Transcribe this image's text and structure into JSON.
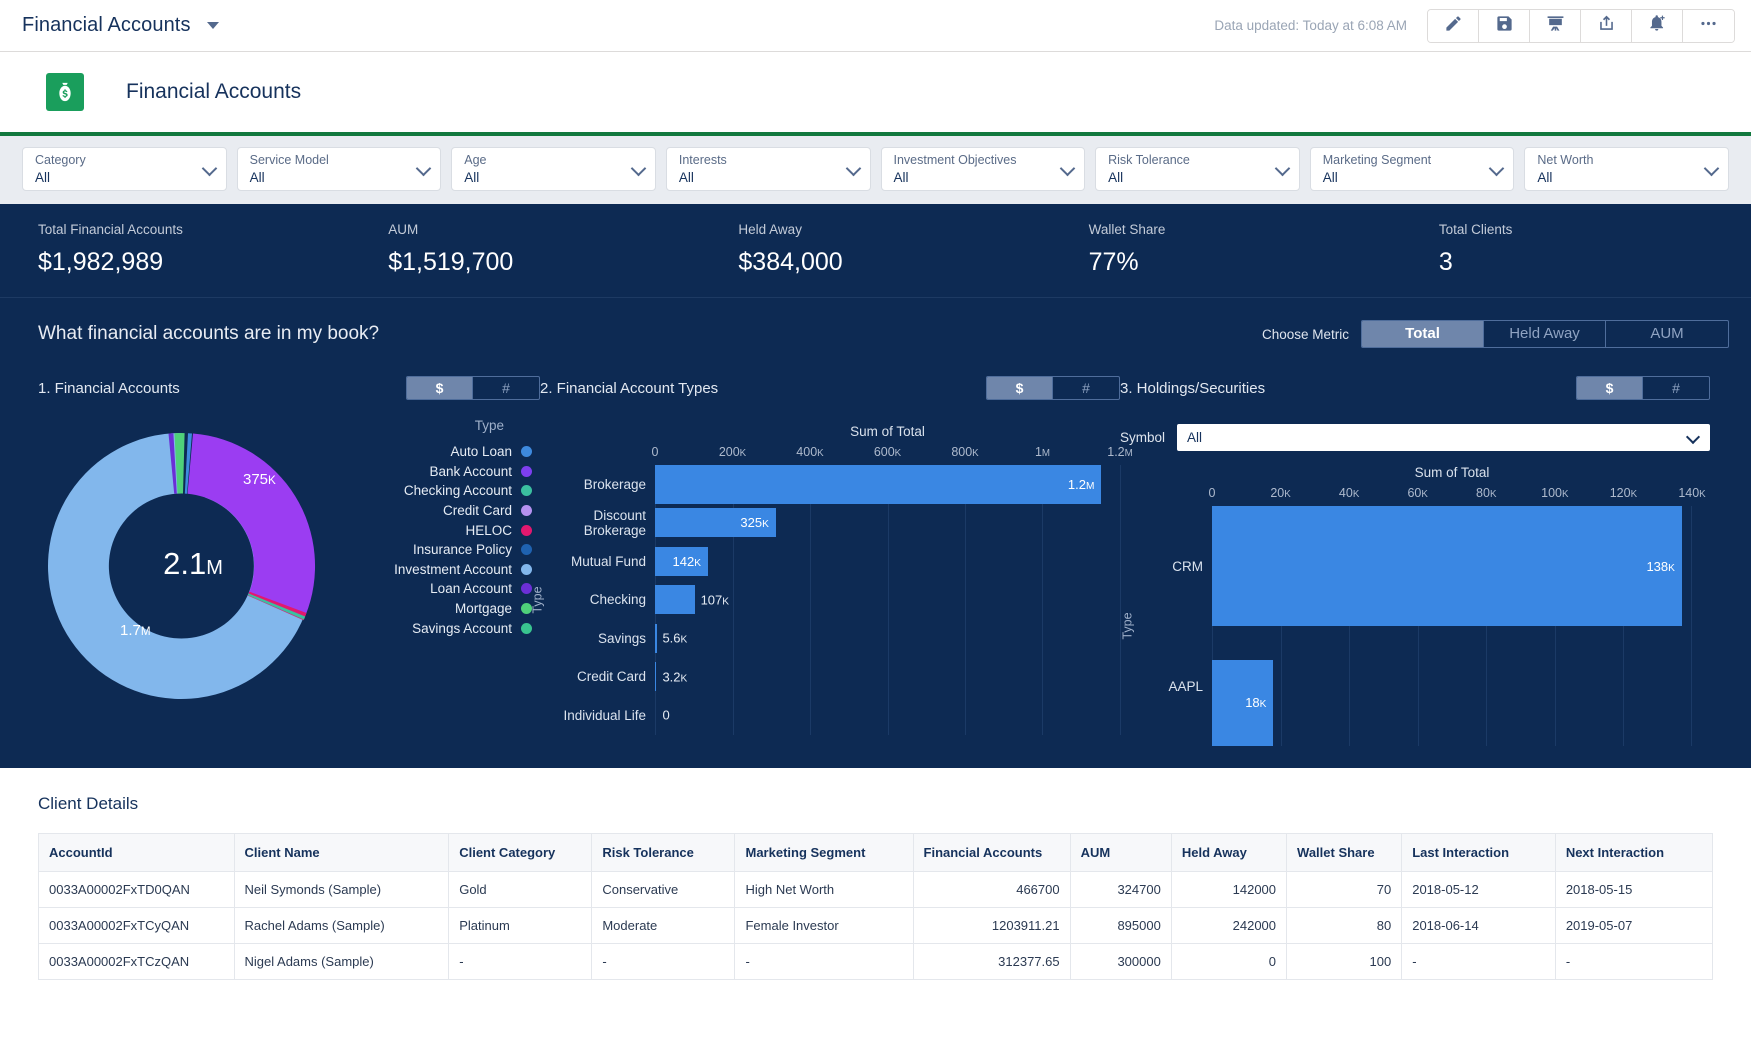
{
  "topbar": {
    "title": "Financial Accounts",
    "data_updated": "Data updated: Today at 6:08 AM",
    "icons": [
      {
        "name": "edit-icon",
        "label": "Edit"
      },
      {
        "name": "save-icon",
        "label": "Save"
      },
      {
        "name": "presentation-icon",
        "label": "Presentation"
      },
      {
        "name": "share-icon",
        "label": "Share"
      },
      {
        "name": "subscribe-bell-icon",
        "label": "Subscribe"
      },
      {
        "name": "more-actions-icon",
        "label": "More"
      }
    ]
  },
  "dashboard": {
    "icon": "money-bag-icon",
    "icon_color": "#1a9e5c",
    "title": "Financial Accounts"
  },
  "filters": [
    {
      "label": "Category",
      "value": "All"
    },
    {
      "label": "Service Model",
      "value": "All"
    },
    {
      "label": "Age",
      "value": "All"
    },
    {
      "label": "Interests",
      "value": "All"
    },
    {
      "label": "Investment Objectives",
      "value": "All"
    },
    {
      "label": "Risk Tolerance",
      "value": "All"
    },
    {
      "label": "Marketing Segment",
      "value": "All"
    },
    {
      "label": "Net Worth",
      "value": "All"
    }
  ],
  "kpis": [
    {
      "label": "Total Financial Accounts",
      "value": "$1,982,989"
    },
    {
      "label": "AUM",
      "value": "$1,519,700"
    },
    {
      "label": "Held Away",
      "value": "$384,000"
    },
    {
      "label": "Wallet Share",
      "value": "77%"
    },
    {
      "label": "Total Clients",
      "value": "3"
    }
  ],
  "panel": {
    "question": "What financial accounts are in my book?",
    "metric_label": "Choose Metric",
    "metric_options": [
      "Total",
      "Held Away",
      "AUM"
    ],
    "metric_selected": "Total"
  },
  "sections": [
    {
      "title": "1. Financial Accounts",
      "toggle": [
        "$",
        "#"
      ],
      "selected": "$"
    },
    {
      "title": "2. Financial Account Types",
      "toggle": [
        "$",
        "#"
      ],
      "selected": "$"
    },
    {
      "title": "3. Holdings/Securities",
      "toggle": [
        "$",
        "#"
      ],
      "selected": "$"
    }
  ],
  "symbol_filter": {
    "label": "Symbol",
    "value": "All"
  },
  "chart_data": [
    {
      "type": "pie",
      "id": "financial-accounts-donut",
      "title": "1. Financial Accounts",
      "center_value": "2.1M",
      "legend_title": "Type",
      "legend_position": "right",
      "labels": [
        "Auto Loan",
        "Bank Account",
        "Checking Account",
        "Credit Card",
        "HELOC",
        "Insurance Policy",
        "Investment Account",
        "Loan Account",
        "Mortgage",
        "Savings Account"
      ],
      "colors": [
        "#3e8ade",
        "#7d3ff0",
        "#3bbfa0",
        "#b591f0",
        "#e2186f",
        "#1f62b0",
        "#82b7ec",
        "#6b2fd6",
        "#4fd07a",
        "#39c48f"
      ],
      "values": [
        9500,
        375000,
        5600,
        3200,
        12000,
        8000,
        1700000,
        6000,
        18000,
        9000
      ],
      "visible_labels": [
        {
          "text": "375K",
          "category": "Bank Account"
        },
        {
          "text": "1.7M",
          "category": "Investment Account"
        }
      ]
    },
    {
      "type": "bar",
      "id": "financial-account-types-bar",
      "orientation": "horizontal",
      "title": "Sum of Total",
      "ylabel": "Type",
      "categories": [
        "Brokerage",
        "Discount Brokerage",
        "Mutual Fund",
        "Checking",
        "Savings",
        "Credit Card",
        "Individual Life"
      ],
      "values": [
        1200000,
        325000,
        142000,
        107000,
        5600,
        3200,
        0
      ],
      "value_labels": [
        "1.2M",
        "325K",
        "142K",
        "107K",
        "5.6K",
        "3.2K",
        "0"
      ],
      "ticks": [
        "0",
        "200K",
        "400K",
        "600K",
        "800K",
        "1M",
        "1.2M"
      ],
      "tick_values": [
        0,
        200000,
        400000,
        600000,
        800000,
        1000000,
        1200000
      ],
      "xlim": [
        0,
        1250000
      ],
      "bar_color": "#3a87e3",
      "grid": true
    },
    {
      "type": "bar",
      "id": "holdings-securities-bar",
      "orientation": "horizontal",
      "title": "Sum of Total",
      "ylabel": "Type",
      "categories": [
        "CRM",
        "AAPL"
      ],
      "values": [
        138000,
        18000
      ],
      "value_labels": [
        "138K",
        "18K"
      ],
      "ticks": [
        "0",
        "20K",
        "40K",
        "60K",
        "80K",
        "100K",
        "120K",
        "140K"
      ],
      "tick_values": [
        0,
        20000,
        40000,
        60000,
        80000,
        100000,
        120000,
        140000
      ],
      "xlim": [
        0,
        141000
      ],
      "bar_color": "#3a87e3",
      "grid": true
    }
  ],
  "details": {
    "title": "Client Details",
    "columns": [
      "AccountId",
      "Client Name",
      "Client Category",
      "Risk Tolerance",
      "Marketing Segment",
      "Financial Accounts",
      "AUM",
      "Held Away",
      "Wallet Share",
      "Last Interaction",
      "Next Interaction"
    ],
    "numeric_columns": [
      5,
      6,
      7,
      8
    ],
    "rows": [
      [
        "0033A00002FxTD0QAN",
        "Neil Symonds (Sample)",
        "Gold",
        "Conservative",
        "High Net Worth",
        "466700",
        "324700",
        "142000",
        "70",
        "2018-05-12",
        "2018-05-15"
      ],
      [
        "0033A00002FxTCyQAN",
        "Rachel Adams (Sample)",
        "Platinum",
        "Moderate",
        "Female Investor",
        "1203911.21",
        "895000",
        "242000",
        "80",
        "2018-06-14",
        "2019-05-07"
      ],
      [
        "0033A00002FxTCzQAN",
        "Nigel Adams (Sample)",
        "-",
        "-",
        "-",
        "312377.65",
        "300000",
        "0",
        "100",
        "-",
        "-"
      ]
    ]
  }
}
